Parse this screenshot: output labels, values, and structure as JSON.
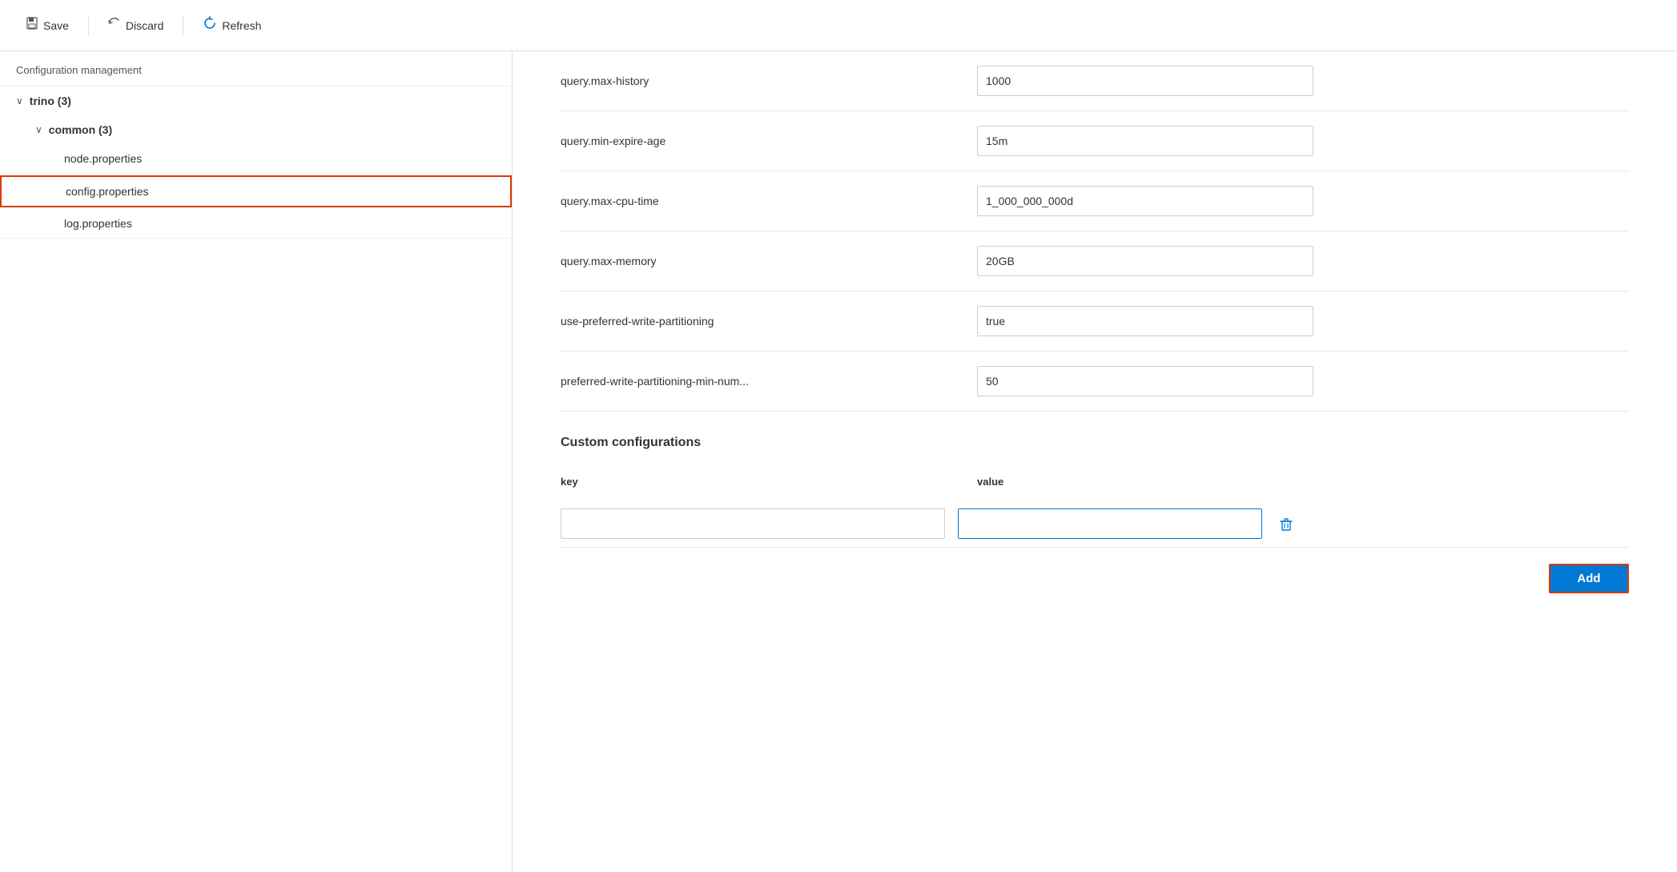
{
  "toolbar": {
    "save_label": "Save",
    "discard_label": "Discard",
    "refresh_label": "Refresh"
  },
  "sidebar": {
    "header": "Configuration management",
    "tree": [
      {
        "id": "trino",
        "label": "trino (3)",
        "level": 0,
        "expanded": true,
        "chevron": "∨"
      },
      {
        "id": "common",
        "label": "common (3)",
        "level": 1,
        "expanded": true,
        "chevron": "∨"
      },
      {
        "id": "node-properties",
        "label": "node.properties",
        "level": 2,
        "selected": false
      },
      {
        "id": "config-properties",
        "label": "config.properties",
        "level": 2,
        "selected": true
      },
      {
        "id": "log-properties",
        "label": "log.properties",
        "level": 2,
        "selected": false
      }
    ]
  },
  "config": {
    "rows": [
      {
        "key": "query.max-history",
        "value": "1000"
      },
      {
        "key": "query.min-expire-age",
        "value": "15m"
      },
      {
        "key": "query.max-cpu-time",
        "value": "1_000_000_000d"
      },
      {
        "key": "query.max-memory",
        "value": "20GB"
      },
      {
        "key": "use-preferred-write-partitioning",
        "value": "true"
      },
      {
        "key": "preferred-write-partitioning-min-num...",
        "value": "50"
      }
    ]
  },
  "custom_configs": {
    "title": "Custom configurations",
    "col_key": "key",
    "col_value": "value",
    "rows": [
      {
        "key": "",
        "value": ""
      }
    ],
    "add_label": "Add"
  }
}
